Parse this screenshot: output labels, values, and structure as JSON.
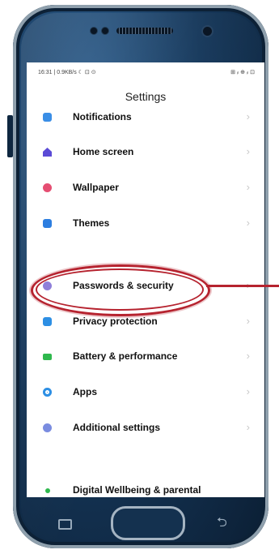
{
  "status_bar": {
    "left": "16:31 | 0.9KB/s ☾ ⊡ ⊙",
    "right": "⊞ ᵢₗ ⊕ ᵢₗ ⊡"
  },
  "title": "Settings",
  "items": [
    {
      "label": "Notifications",
      "icon": "bell-icon"
    },
    {
      "label": "Home screen",
      "icon": "home-icon"
    },
    {
      "label": "Wallpaper",
      "icon": "wallpaper-icon"
    },
    {
      "label": "Themes",
      "icon": "themes-icon"
    },
    {
      "label": "Passwords & security",
      "icon": "lock-icon"
    },
    {
      "label": "Privacy protection",
      "icon": "privacy-icon"
    },
    {
      "label": "Battery & performance",
      "icon": "battery-icon"
    },
    {
      "label": "Apps",
      "icon": "apps-icon"
    },
    {
      "label": "Additional settings",
      "icon": "more-icon"
    },
    {
      "label": "Digital Wellbeing & parental",
      "icon": "wellbeing-icon"
    }
  ],
  "chevron": "›",
  "nav": {
    "back": "⮌"
  },
  "colors": {
    "annotation": "#b6232f",
    "phone_body": "#16385b"
  }
}
